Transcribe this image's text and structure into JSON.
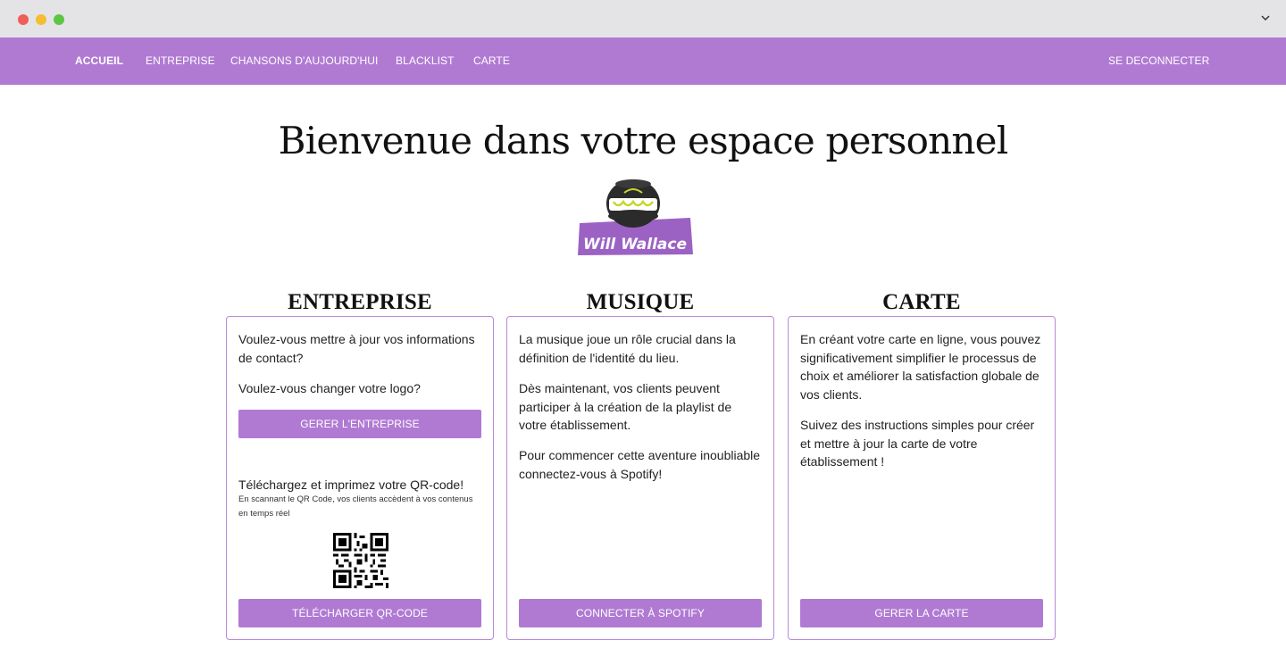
{
  "nav": {
    "items": [
      "ACCUEIL",
      "ENTREPRISE",
      "CHANSONS D'AUJOURD'HUI",
      "BLACKLIST",
      "CARTE"
    ],
    "logout": "SE DECONNECTER"
  },
  "title": "Bienvenue dans votre espace personnel",
  "logo": {
    "text": "Will Wallace"
  },
  "entreprise": {
    "title": "ENTREPRISE",
    "p1": "Voulez-vous mettre à jour vos informations de contact?",
    "p2": "Voulez-vous changer votre logo?",
    "button": "GERER L'ENTREPRISE",
    "qr_heading": "Téléchargez et imprimez votre QR-code!",
    "qr_sub": "En scannant le QR Code, vos clients accèdent à vos contenus en temps réel",
    "download_button": "TÉLÉCHARGER QR-CODE"
  },
  "musique": {
    "title": "MUSIQUE",
    "p1": "La musique joue un rôle crucial dans la définition de l'identité du lieu.",
    "p2": "Dès maintenant, vos clients peuvent participer à la création de la playlist de votre établissement.",
    "p3": "Pour commencer cette aventure inoubliable connectez-vous à Spotify!",
    "button": "CONNECTER À SPOTIFY"
  },
  "carte": {
    "title": "CARTE",
    "p1": "En créant votre carte en ligne, vous pouvez significativement simplifier le processus de choix et améliorer la satisfaction globale de vos clients.",
    "p2": "Suivez des instructions simples pour créer et mettre à jour la carte de votre établissement !",
    "button": "GERER LA CARTE"
  },
  "colors": {
    "accent": "#b07ad3",
    "card_border": "#b98ad8"
  },
  "icons": [
    "chevron-down-icon",
    "qr-code-icon",
    "will-wallace-logo"
  ]
}
